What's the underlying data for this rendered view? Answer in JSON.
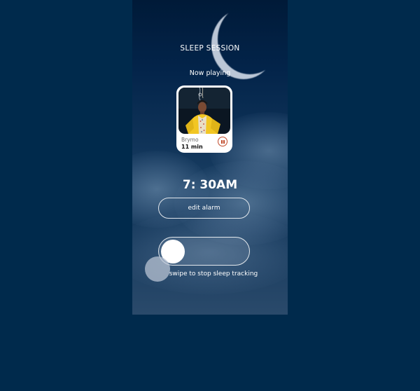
{
  "screen": {
    "title": "SLEEP SESSION",
    "now_playing_label": "Now playing"
  },
  "track": {
    "artist": "Brymo",
    "duration": "11 min",
    "cover_icon": "album-cover",
    "control_icon": "pause-icon"
  },
  "alarm": {
    "time": "7: 30AM",
    "edit_label": "edit alarm"
  },
  "swipe": {
    "label": "swipe to stop sleep tracking"
  },
  "colors": {
    "background": "#002a4c",
    "accent": "#c04a2a",
    "cover_yellow": "#f2c623"
  }
}
